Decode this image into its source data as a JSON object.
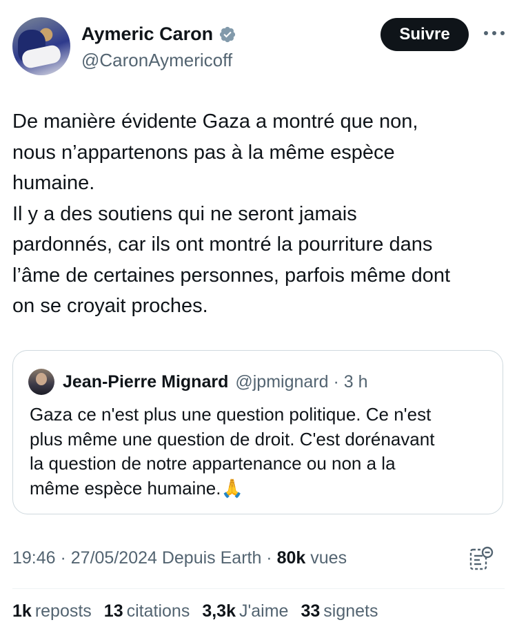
{
  "author": {
    "name": "Aymeric Caron",
    "handle": "@CaronAymericoff",
    "follow_label": "Suivre"
  },
  "tweet": {
    "text": "De manière évidente Gaza a montré que non,\nnous n’appartenons pas à la même espèce\nhumaine.\nIl y a des soutiens qui ne seront jamais\npardonnés, car ils ont montré la pourriture dans\nl’âme de certaines personnes, parfois même dont\non se croyait proches."
  },
  "quote": {
    "name": "Jean-Pierre Mignard",
    "handle_time": "@jpmignard · 3 h",
    "text": "Gaza ce n'est plus une question politique. Ce n'est\nplus même une question de droit.  C'est dorénavant\nla question de notre appartenance ou non a la\nmême espèce humaine.🙏"
  },
  "meta": {
    "time_date_source": "19:46 · 27/05/2024 Depuis Earth · ",
    "views_count": "80k",
    "views_label": "vues"
  },
  "stats": {
    "reposts_count": "1k",
    "reposts_label": "reposts",
    "quotes_count": "13",
    "quotes_label": "citations",
    "likes_count": "3,3k",
    "likes_label": "J'aime",
    "bookmarks_count": "33",
    "bookmarks_label": "signets"
  },
  "colors": {
    "text": "#0f1419",
    "secondary": "#536471",
    "border": "#cfd9de",
    "verified_badge": "#829aab"
  }
}
